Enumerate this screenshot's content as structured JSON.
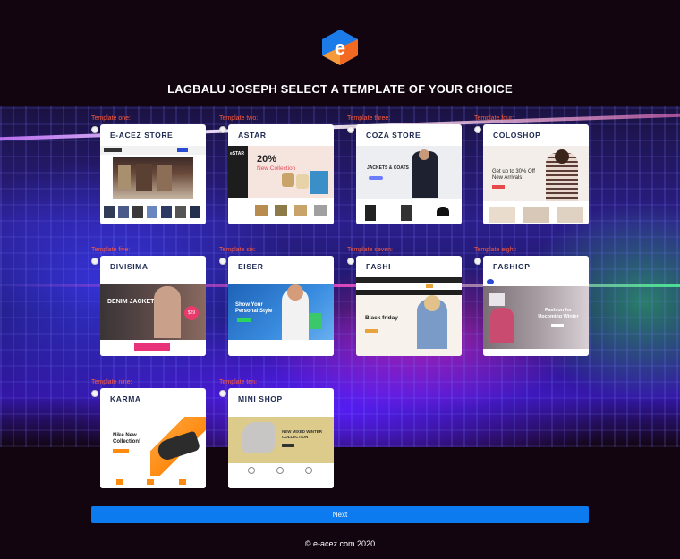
{
  "header": {
    "title": "LAGBALU JOSEPH SELECT A TEMPLATE OF YOUR CHOICE"
  },
  "templates": [
    {
      "slot_label": "Template one:",
      "name": "E-ACEZ STORE"
    },
    {
      "slot_label": "Template two:",
      "name": "ASTAR"
    },
    {
      "slot_label": "Template three:",
      "name": "COZA STORE"
    },
    {
      "slot_label": "Template four:",
      "name": "COLOSHOP"
    },
    {
      "slot_label": "Template five:",
      "name": "DIVISIMA"
    },
    {
      "slot_label": "Template six:",
      "name": "EISER"
    },
    {
      "slot_label": "Template seven:",
      "name": "FASHI"
    },
    {
      "slot_label": "Template eight:",
      "name": "FASHIOP"
    },
    {
      "slot_label": "Template nine:",
      "name": "KARMA"
    },
    {
      "slot_label": "Template ten:",
      "name": "MINI SHOP"
    }
  ],
  "previews": {
    "astar_headline": "20%",
    "astar_sub": "New Collection",
    "astar_logo": "eSTAR",
    "coza_headline": "JACKETS & COATS",
    "coloshop_headline": "Get up to 30% Off New Arrivals",
    "divisima_headline": "DENIM JACKETS",
    "divisima_price": "$29",
    "eiser_headline": "Show Your Personal Style",
    "fashi_headline": "Black friday",
    "fashiop_headline": "Fashion for Upcoming Winter",
    "karma_headline": "Nike New Collection!",
    "minishop_headline": "NEW MIXED WINTER COLLECTION"
  },
  "actions": {
    "next_label": "Next"
  },
  "footer": {
    "text": "© e-acez.com 2020"
  },
  "colors": {
    "accent": "#0d7bf0",
    "slot_label": "#ff5a3a",
    "card_title": "#1e2a52",
    "page_bg": "#12050f"
  }
}
